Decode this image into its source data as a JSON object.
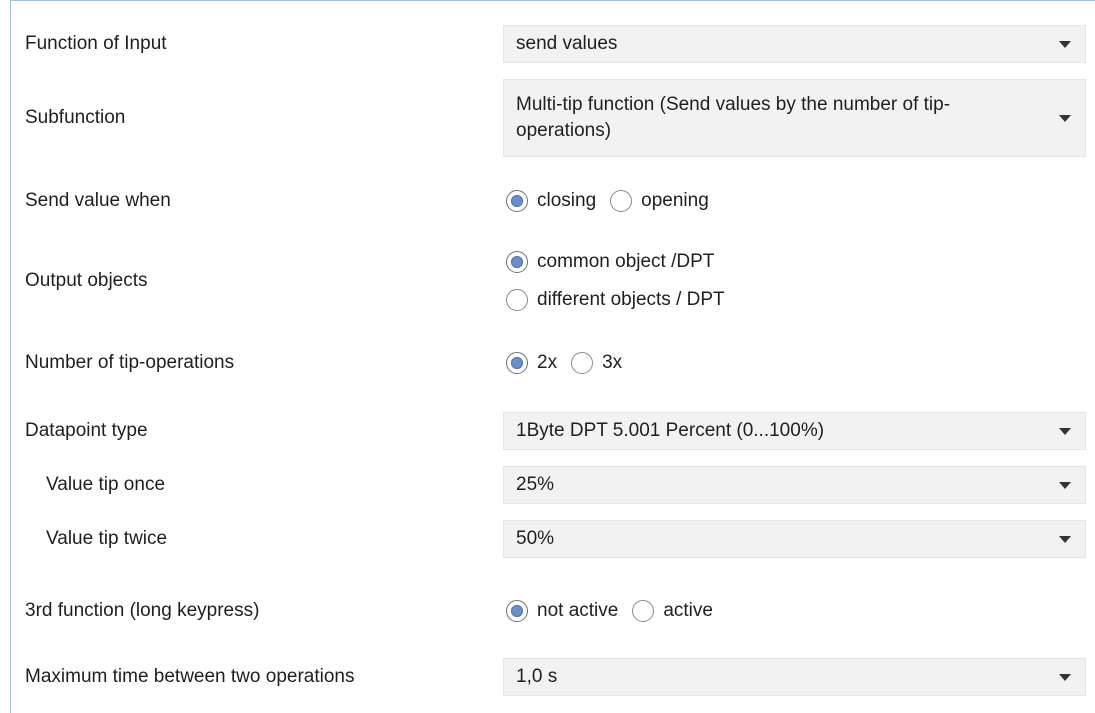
{
  "rows": {
    "function_of_input": {
      "label": "Function of Input",
      "value": "send values"
    },
    "subfunction": {
      "label": "Subfunction",
      "value": "Multi-tip function (Send values by the number of tip-operations)"
    },
    "send_value_when": {
      "label": "Send value when",
      "options": [
        "closing",
        "opening"
      ],
      "selected": "closing"
    },
    "output_objects": {
      "label": "Output objects",
      "options": [
        "common object /DPT",
        "different objects / DPT"
      ],
      "selected": "common object /DPT"
    },
    "number_tip": {
      "label": "Number of tip-operations",
      "options": [
        "2x",
        "3x"
      ],
      "selected": "2x"
    },
    "datapoint_type": {
      "label": "Datapoint type",
      "value": "1Byte DPT 5.001 Percent (0...100%)"
    },
    "value_tip_once": {
      "label": "Value tip once",
      "value": "25%"
    },
    "value_tip_twice": {
      "label": "Value tip twice",
      "value": "50%"
    },
    "third_function": {
      "label": "3rd function (long keypress)",
      "options": [
        "not active",
        "active"
      ],
      "selected": "not active"
    },
    "max_time": {
      "label": "Maximum time between two operations",
      "value": "1,0 s"
    }
  },
  "icons": {
    "dropdown": "chevron-down-icon",
    "radio": "radio-icon"
  },
  "colors": {
    "accent": "#6b8fc4",
    "field_bg": "#f2f2f2",
    "frame": "#9fc0e6"
  }
}
